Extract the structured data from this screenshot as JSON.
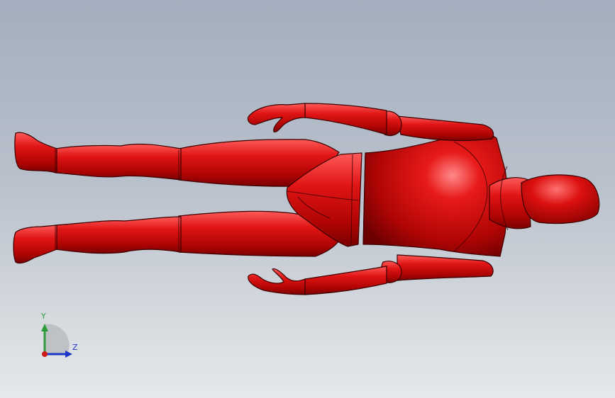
{
  "viewport": {
    "background_top": "#a3afbe",
    "background_bottom": "#e6e8eb",
    "model_color": "#d20f0f",
    "model_highlight": "#ff6a6a",
    "model_shadow": "#6e0000"
  },
  "triad": {
    "y_label": "Y",
    "z_label": "Z",
    "y_color": "#2e9a3a",
    "z_color": "#1d35c8",
    "x_color": "#d01a1a"
  }
}
